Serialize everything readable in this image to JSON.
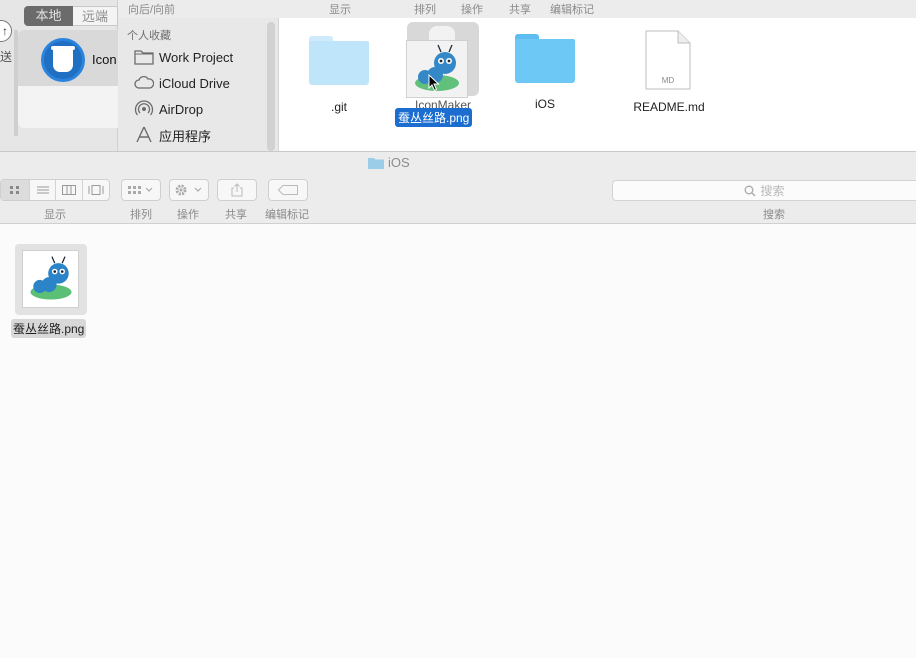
{
  "left_app": {
    "segment_local": "本地",
    "segment_remote": "远端",
    "send_label": "送",
    "app_name": "Icon"
  },
  "back_finder": {
    "toolbar_labels": {
      "back_forward": "向后/向前",
      "view": "显示",
      "arrange": "排列",
      "action": "操作",
      "share": "共享",
      "edit_tags": "编辑标记"
    },
    "sidebar": {
      "header": "个人收藏",
      "items": [
        {
          "label": "Work Project",
          "icon": "folder-icon"
        },
        {
          "label": "iCloud Drive",
          "icon": "cloud-icon"
        },
        {
          "label": "AirDrop",
          "icon": "airdrop-icon"
        },
        {
          "label": "应用程序",
          "icon": "applications-icon"
        }
      ]
    },
    "files": [
      {
        "name": ".git",
        "kind": "folder-faded"
      },
      {
        "name": "IconMaker",
        "kind": "app"
      },
      {
        "name": "iOS",
        "kind": "folder"
      },
      {
        "name": "README.md",
        "kind": "document",
        "badge": "MD"
      }
    ],
    "drag_item": {
      "name": "蚕丛丝路.png"
    }
  },
  "main_finder": {
    "title": "iOS",
    "toolbar": {
      "view_label": "显示",
      "arrange_label": "排列",
      "action_label": "操作",
      "share_label": "共享",
      "edit_tags_label": "编辑标记",
      "search_placeholder": "搜索",
      "search_label": "搜索"
    },
    "files": [
      {
        "name": "蚕丛丝路.png",
        "selected": true
      }
    ]
  },
  "colors": {
    "accent": "#1c6dd0",
    "folder": "#6ec8f5",
    "folder_light": "#bfe5fb"
  }
}
